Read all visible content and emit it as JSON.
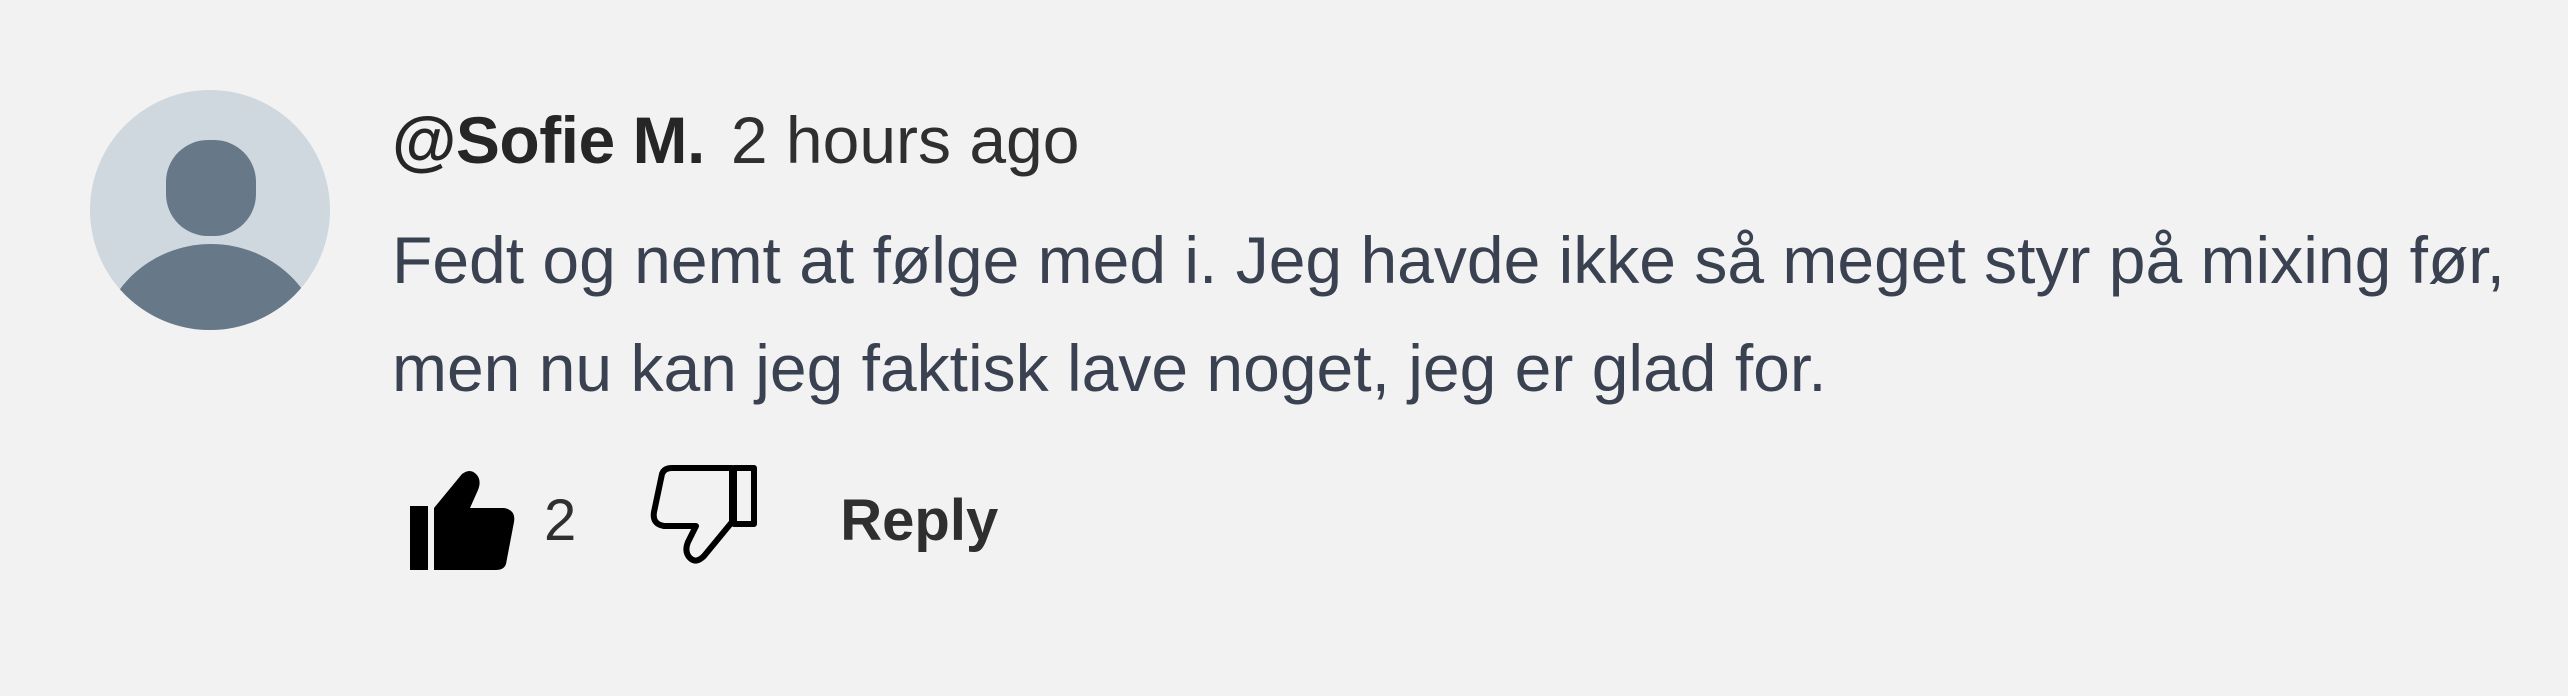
{
  "comment": {
    "username": "@Sofie M.",
    "timestamp": "2 hours ago",
    "text": "Fedt og nemt at følge med i. Jeg havde ikke så meget styr på mixing før, men nu kan jeg faktisk lave noget, jeg er glad for.",
    "avatar_icon": "default-user-avatar-icon",
    "like_icon": "thumbs-up-icon",
    "dislike_icon": "thumbs-down-icon",
    "like_count": "2",
    "reply_label": "Reply"
  },
  "colors": {
    "background": "#f2f2f3",
    "avatar_bg": "#cfd8df",
    "avatar_fg": "#677888",
    "text": "#3a4150",
    "username": "#262626"
  }
}
